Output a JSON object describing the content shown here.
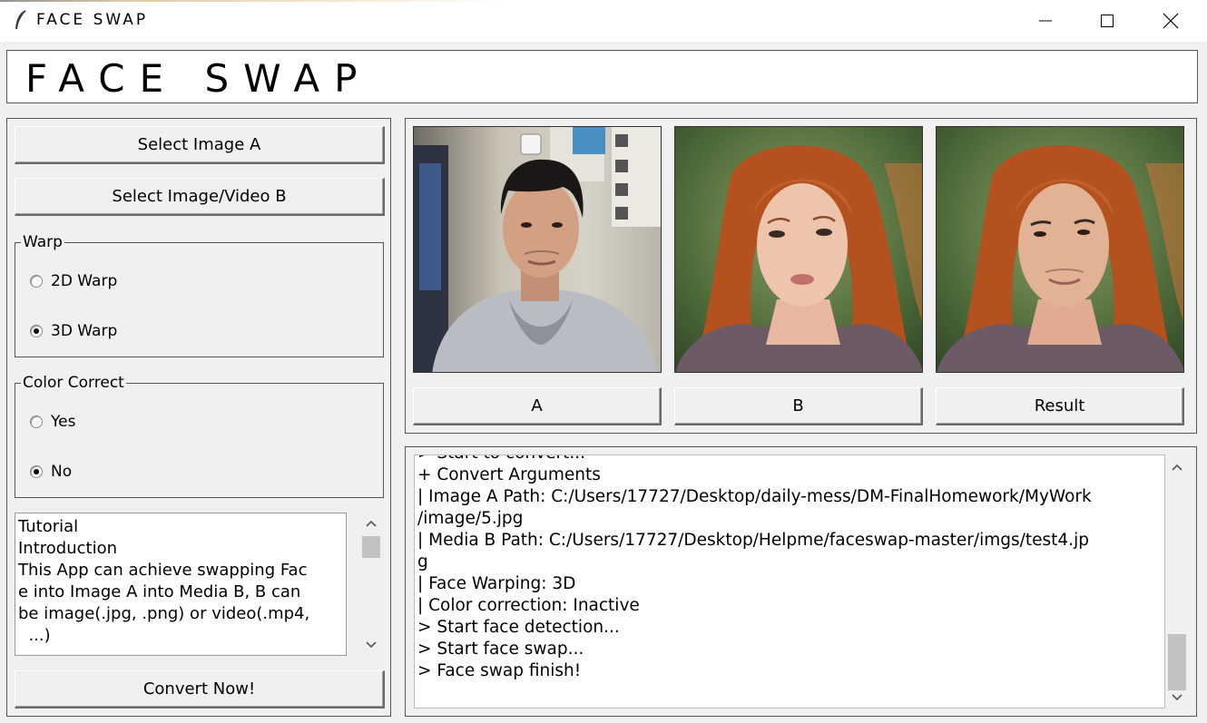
{
  "window": {
    "title": "FACE SWAP"
  },
  "header": {
    "title": "FACE SWAP"
  },
  "left": {
    "select_a_label": "Select Image A",
    "select_b_label": "Select Image/Video B",
    "warp": {
      "legend": "Warp",
      "options": [
        {
          "label": "2D Warp",
          "selected": false
        },
        {
          "label": "3D Warp",
          "selected": true
        }
      ]
    },
    "color_correct": {
      "legend": "Color Correct",
      "options": [
        {
          "label": "Yes",
          "selected": false
        },
        {
          "label": "No",
          "selected": true
        }
      ]
    },
    "tutorial_lines": [
      "Tutorial",
      "",
      "Introduction",
      "This App can achieve swapping Fac",
      "e into Image A into Media B, B can",
      "be image(.jpg, .png) or video(.mp4,",
      "  ...)"
    ],
    "convert_label": "Convert Now!"
  },
  "images": {
    "buttons": [
      "A",
      "B",
      "Result"
    ]
  },
  "log": {
    "lines": [
      "> Start to convert...",
      "+ Convert Arguments",
      "| Image A Path: C:/Users/17727/Desktop/daily-mess/DM-FinalHomework/MyWork",
      "/image/5.jpg",
      "| Media B Path: C:/Users/17727/Desktop/Helpme/faceswap-master/imgs/test4.jp",
      "g",
      "| Face Warping: 3D",
      "| Color correction: Inactive",
      "> Start face detection...",
      "> Start face swap...",
      "> Face swap finish!"
    ]
  }
}
